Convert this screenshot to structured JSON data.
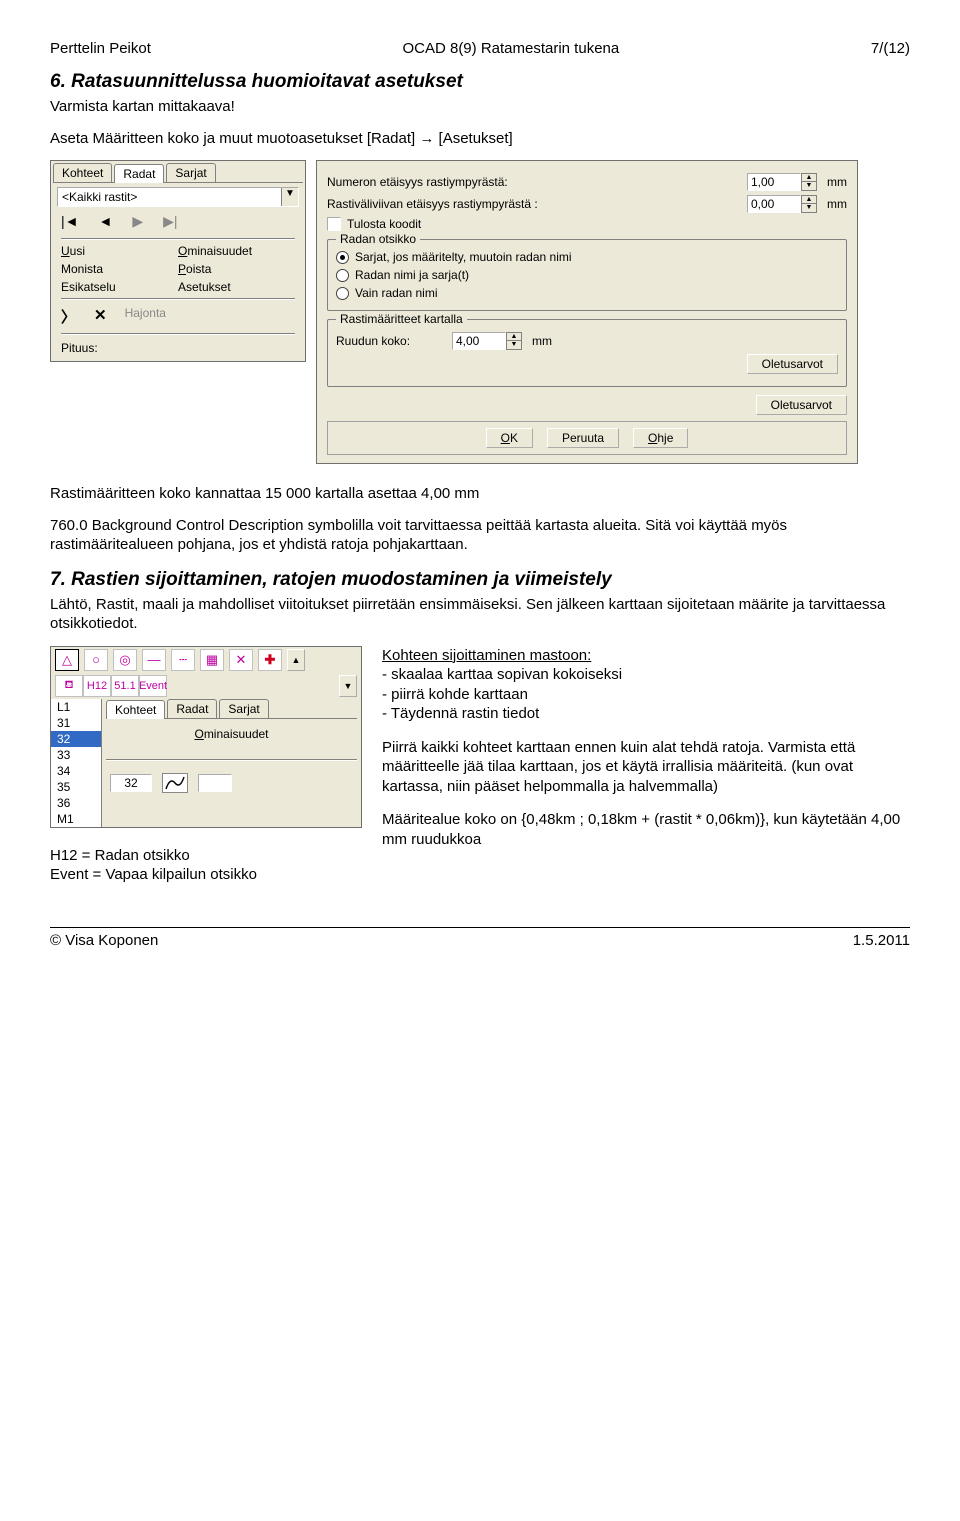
{
  "header": {
    "left": "Perttelin Peikot",
    "center": "OCAD 8(9) Ratamestarin tukena",
    "right": "7/(12)"
  },
  "sec6": {
    "title": "6. Ratasuunnittelussa huomioitavat asetukset",
    "line1": "Varmista kartan mittakaava!",
    "line2": "Aseta Määritteen koko ja muut muotoasetukset [Radat] → [Asetukset]"
  },
  "radat": {
    "tabs": [
      "Kohteet",
      "Radat",
      "Sarjat"
    ],
    "dropdown": "<Kaikki rastit>",
    "links": {
      "uusi": "Uusi",
      "omin": "Ominaisuudet",
      "monista": "Monista",
      "poista": "Poista",
      "esik": "Esikatselu",
      "aset": "Asetukset",
      "hajonta": "Hajonta"
    },
    "pituus": "Pituus:"
  },
  "aset": {
    "row1": "Numeron etäisyys rastiympyrästä:",
    "row2": "Rastiväliviivan etäisyys rastiympyrästä :",
    "val1": "1,00",
    "val2": "0,00",
    "unit": "mm",
    "tulosta": "Tulosta koodit",
    "grp1": "Radan otsikko",
    "r1": "Sarjat, jos määritelty, muutoin radan nimi",
    "r2": "Radan nimi ja sarja(t)",
    "r3": "Vain radan nimi",
    "grp2": "Rastimääritteet kartalla",
    "ruutu": "Ruudun koko:",
    "ruutuVal": "4,00",
    "oletus": "Oletusarvot",
    "ok": "OK",
    "peruuta": "Peruuta",
    "ohje": "Ohje"
  },
  "mid1": "Rastimääritteen koko kannattaa 15 000 kartalla asettaa 4,00 mm",
  "mid2": "760.0 Background Control Description symbolilla voit tarvittaessa peittää kartasta alueita. Sitä voi käyttää myös rastimääritealueen pohjana, jos et yhdistä ratoja pohjakarttaan.",
  "sec7": {
    "title": "7. Rastien sijoittaminen, ratojen muodostaminen ja viimeistely",
    "p": "Lähtö, Rastit, maali ja mahdolliset viitoitukset piirretään ensimmäiseksi. Sen jälkeen karttaan sijoitetaan määrite ja tarvittaessa otsikkotiedot."
  },
  "toolpanel": {
    "tabs": [
      "Kohteet",
      "Radat",
      "Sarjat"
    ],
    "list": [
      "L1",
      "31",
      "32",
      "33",
      "34",
      "35",
      "36",
      "M1"
    ],
    "sel": "32",
    "om": "Ominaisuudet",
    "code": "32",
    "row2": [
      "H12",
      "51.1",
      "Event"
    ]
  },
  "righttext": {
    "u1": "Kohteen sijoittaminen mastoon:",
    "b1": "- skaalaa karttaa sopivan kokoiseksi",
    "b2": "- piirrä kohde karttaan",
    "b3": "- Täydennä rastin tiedot",
    "p2": "Piirrä kaikki kohteet karttaan ennen kuin alat tehdä ratoja. Varmista että määritteelle jää tilaa karttaan, jos et käytä irrallisia määriteitä. (kun ovat kartassa, niin pääset helpommalla ja halvemmalla)",
    "p3": "Määritealue koko on {0,48km ;  0,18km + (rastit * 0,06km)}, kun käytetään 4,00 mm ruudukkoa"
  },
  "caption": {
    "l1": "H12 = Radan otsikko",
    "l2": "Event = Vapaa kilpailun otsikko"
  },
  "footer": {
    "left": "© Visa Koponen",
    "right": "1.5.2011"
  }
}
